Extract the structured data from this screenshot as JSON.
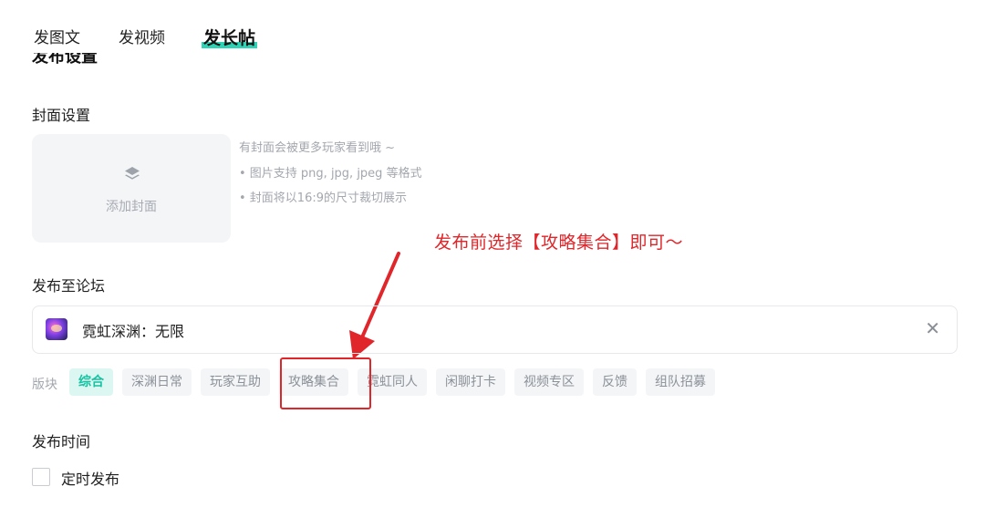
{
  "tabs": [
    {
      "label": "发图文",
      "active": false
    },
    {
      "label": "发视频",
      "active": false
    },
    {
      "label": "发长帖",
      "active": true
    }
  ],
  "publish_settings": {
    "title": "发布设置"
  },
  "cover": {
    "title": "封面设置",
    "add_label": "添加封面",
    "icon": "layers-icon",
    "hints": [
      "有封面会被更多玩家看到哦 ~",
      "• 图片支持 png, jpg, jpeg 等格式",
      "• 封面将以16:9的尺寸裁切展示"
    ]
  },
  "annotation": {
    "text": "发布前选择【攻略集合】即可～",
    "color": "#e0262a"
  },
  "forum": {
    "title": "发布至论坛",
    "selected_name": "霓虹深渊：无限",
    "close_icon": "close-icon"
  },
  "boards": {
    "label": "版块",
    "items": [
      "综合",
      "深渊日常",
      "玩家互助",
      "攻略集合",
      "霓虹同人",
      "闲聊打卡",
      "视频专区",
      "反馈",
      "组队招募"
    ],
    "selected": "综合",
    "highlighted": "攻略集合"
  },
  "publish_time": {
    "title": "发布时间",
    "scheduled_label": "定时发布",
    "scheduled_checked": false
  },
  "colors": {
    "accent": "#17c2a2",
    "tab_underline": "#2ed2b4",
    "annotation_red": "#e0262a"
  }
}
